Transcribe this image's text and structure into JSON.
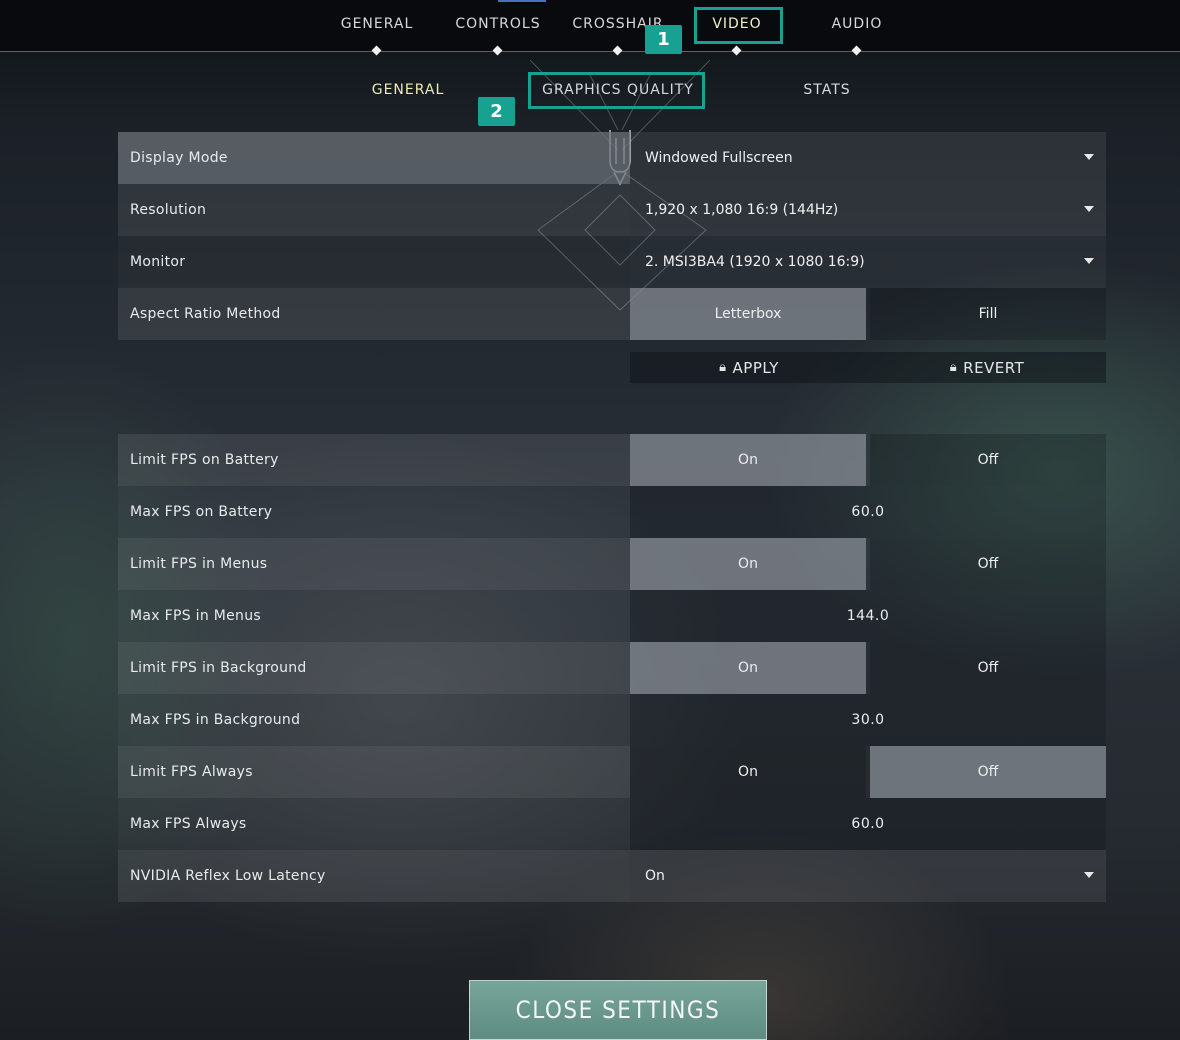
{
  "top_tabs": [
    {
      "label": "GENERAL"
    },
    {
      "label": "CONTROLS"
    },
    {
      "label": "CROSSHAIR"
    },
    {
      "label": "VIDEO"
    },
    {
      "label": "AUDIO"
    }
  ],
  "sub_tabs": [
    {
      "label": "GENERAL"
    },
    {
      "label": "GRAPHICS QUALITY"
    },
    {
      "label": "STATS"
    }
  ],
  "annotations": {
    "badge_1": "1",
    "badge_2": "2",
    "color": "#16a190"
  },
  "rows": {
    "display_mode": {
      "label": "Display Mode",
      "value": "Windowed Fullscreen"
    },
    "resolution": {
      "label": "Resolution",
      "value": "1,920 x 1,080 16:9 (144Hz)"
    },
    "monitor": {
      "label": "Monitor",
      "value": "2. MSI3BA4 (1920 x  1080 16:9)"
    },
    "aspect_ratio": {
      "label": "Aspect Ratio Method",
      "option_a": "Letterbox",
      "option_b": "Fill",
      "selected": "Letterbox"
    },
    "limit_fps_battery": {
      "label": "Limit FPS on Battery",
      "on": "On",
      "off": "Off",
      "selected": "On"
    },
    "max_fps_battery": {
      "label": "Max FPS on Battery",
      "value": "60.0"
    },
    "limit_fps_menus": {
      "label": "Limit FPS in Menus",
      "on": "On",
      "off": "Off",
      "selected": "On"
    },
    "max_fps_menus": {
      "label": "Max FPS in Menus",
      "value": "144.0"
    },
    "limit_fps_background": {
      "label": "Limit FPS in Background",
      "on": "On",
      "off": "Off",
      "selected": "On"
    },
    "max_fps_background": {
      "label": "Max FPS in Background",
      "value": "30.0"
    },
    "limit_fps_always": {
      "label": "Limit FPS Always",
      "on": "On",
      "off": "Off",
      "selected": "Off"
    },
    "max_fps_always": {
      "label": "Max FPS Always",
      "value": "60.0"
    },
    "nvidia_reflex": {
      "label": "NVIDIA Reflex Low Latency",
      "value": "On"
    }
  },
  "actions": {
    "apply": "APPLY",
    "revert": "REVERT",
    "lock_icon": "lock-icon"
  },
  "close_button": "CLOSE SETTINGS"
}
